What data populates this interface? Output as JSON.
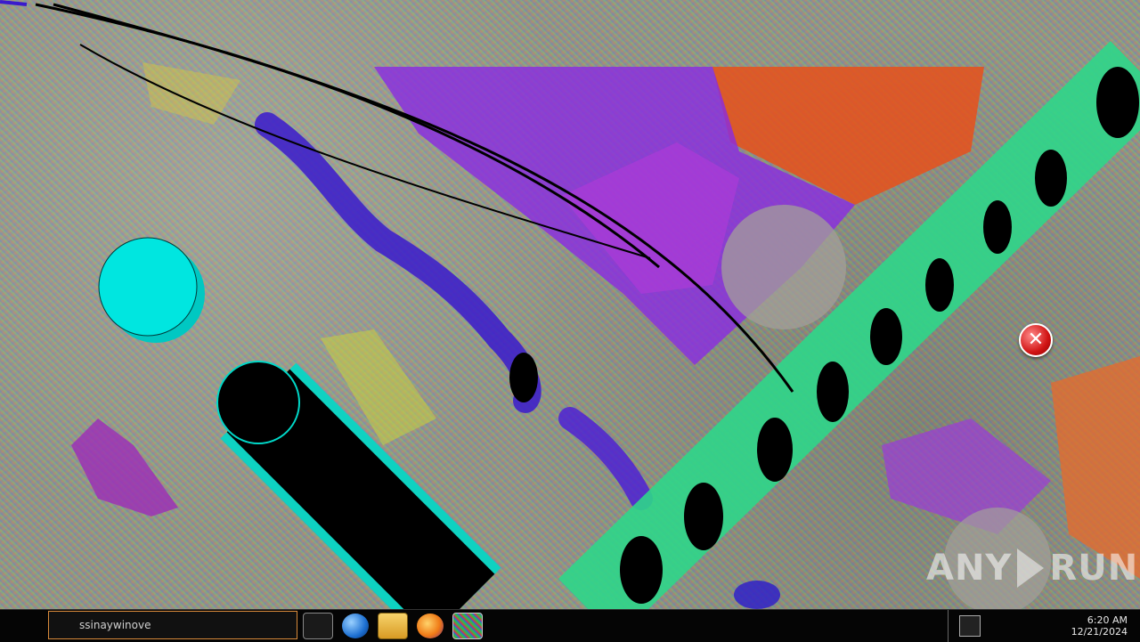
{
  "taskbar": {
    "window_title": "ssinaywinove",
    "clock_time": "6:20 AM",
    "clock_date": "12/21/2024"
  },
  "watermark": {
    "left_text": "ANY",
    "right_text": "RUN"
  },
  "icons": {
    "error": "error-x-icon",
    "quick_launch": [
      "show-desktop-icon",
      "internet-explorer-icon",
      "file-explorer-icon",
      "firefox-icon",
      "app-icon"
    ]
  },
  "colors": {
    "taskbar": "#050505",
    "cyan_ball": "#00e6e0",
    "tube_green": "#2fd68a",
    "purple": "#8a2be2",
    "orange": "#e8501a",
    "error_red": "#d11414"
  }
}
